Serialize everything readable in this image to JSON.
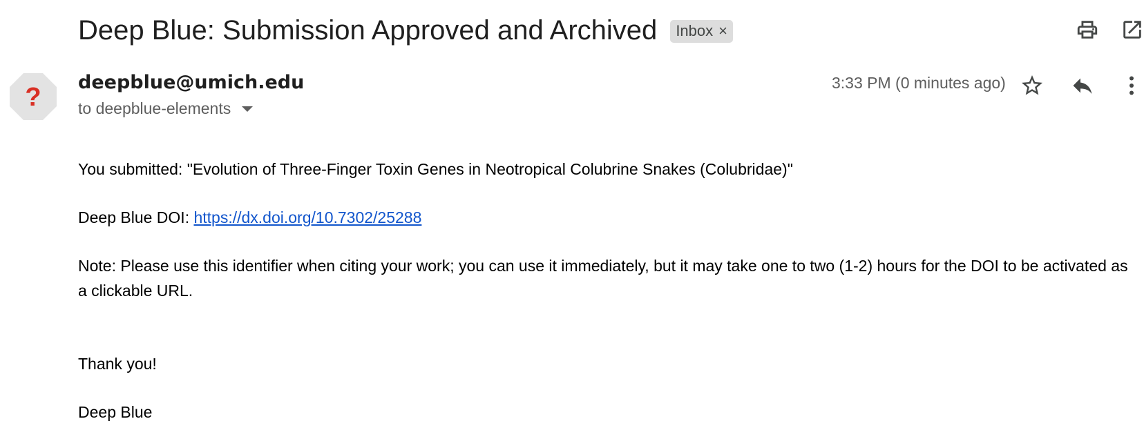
{
  "email": {
    "subject": "Deep Blue: Submission Approved and Archived",
    "label": "Inbox",
    "label_close": "×",
    "sender": "deepblue@umich.edu",
    "recipient_prefix": "to deepblue-elements",
    "timestamp": "3:33 PM (0 minutes ago)",
    "avatar_glyph": "?",
    "body": {
      "submitted": "You submitted: \"Evolution of Three-Finger Toxin Genes in Neotropical Colubrine Snakes (Colubridae)\"",
      "doi_label": "Deep Blue DOI: ",
      "doi_link": "https://dx.doi.org/10.7302/25288",
      "note": "Note: Please use this identifier when citing your work; you can use it immediately, but it may take one to two (1-2) hours for the DOI to be activated as a clickable URL.",
      "thanks": "Thank you!",
      "signature": "Deep Blue"
    }
  },
  "icons": {
    "print": "print-icon",
    "open_new_window": "open-in-new-window-icon",
    "star": "star-icon",
    "reply": "reply-icon",
    "more": "more-vert-icon",
    "recipient_details": "chevron-down-icon",
    "avatar": "unknown-sender-avatar"
  },
  "colors": {
    "link": "#1155cc",
    "avatar_bg": "#e3e3e3",
    "avatar_glyph": "#d93025",
    "chip_bg": "#dddddd"
  }
}
